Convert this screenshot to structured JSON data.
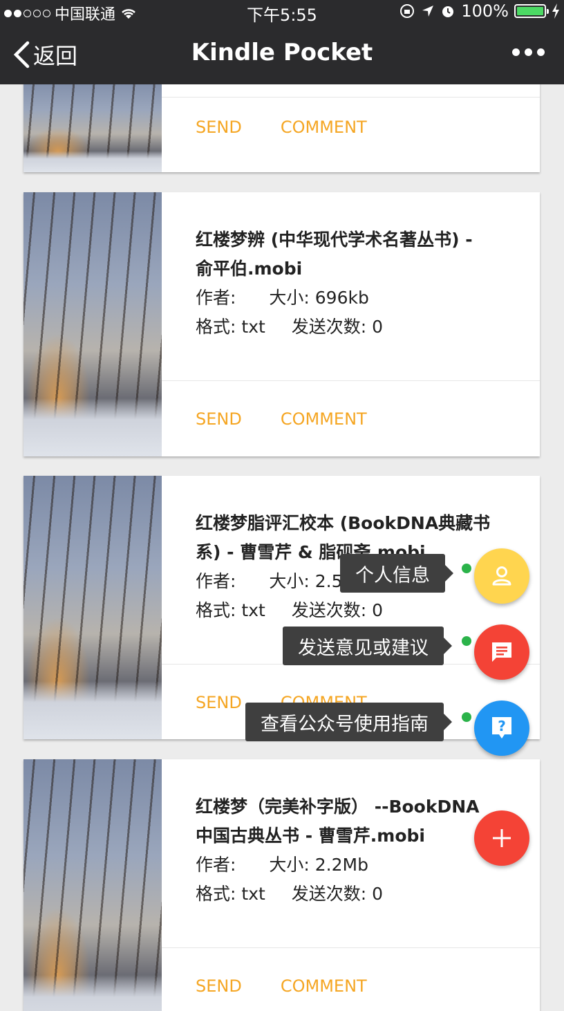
{
  "status_bar": {
    "carrier": "中国联通",
    "time": "下午5:55",
    "battery": "100%",
    "battery_level": 100
  },
  "nav": {
    "back_label": "返回",
    "title": "Kindle Pocket"
  },
  "card_actions": {
    "send": "SEND",
    "comment": "COMMENT"
  },
  "books": [
    {
      "title_line1": "红楼梦辨 (中华现代学术名著丛书) -",
      "title_line2": "俞平伯.mobi",
      "author_label": "作者:",
      "author": "",
      "size_label": "大小:",
      "size": "696kb",
      "format_label": "格式:",
      "format": "txt",
      "sends_label": "发送次数:",
      "sends": "0"
    },
    {
      "title_line1": "红楼梦脂评汇校本 (BookDNA典藏书",
      "title_line2": "系) - 曹雪芹 & 脂砚斋.mobi",
      "author_label": "作者:",
      "author": "",
      "size_label": "大小:",
      "size": "2.5Mb",
      "format_label": "格式:",
      "format": "txt",
      "sends_label": "发送次数:",
      "sends": "0"
    },
    {
      "title_line1": "红楼梦（完美补字版） --BookDNA",
      "title_line2": "中国古典丛书 - 曹雪芹.mobi",
      "author_label": "作者:",
      "author": "",
      "size_label": "大小:",
      "size": "2.2Mb",
      "format_label": "格式:",
      "format": "txt",
      "sends_label": "发送次数:",
      "sends": "0"
    }
  ],
  "fab_menu": {
    "profile": "个人信息",
    "feedback": "发送意见或建议",
    "guide": "查看公众号使用指南",
    "main_icon": "plus-icon"
  },
  "colors": {
    "action_orange": "#f5a623",
    "fab_yellow": "#ffd54f",
    "fab_red": "#f44336",
    "fab_blue": "#2196f3",
    "indicator_green": "#2bb34a"
  }
}
